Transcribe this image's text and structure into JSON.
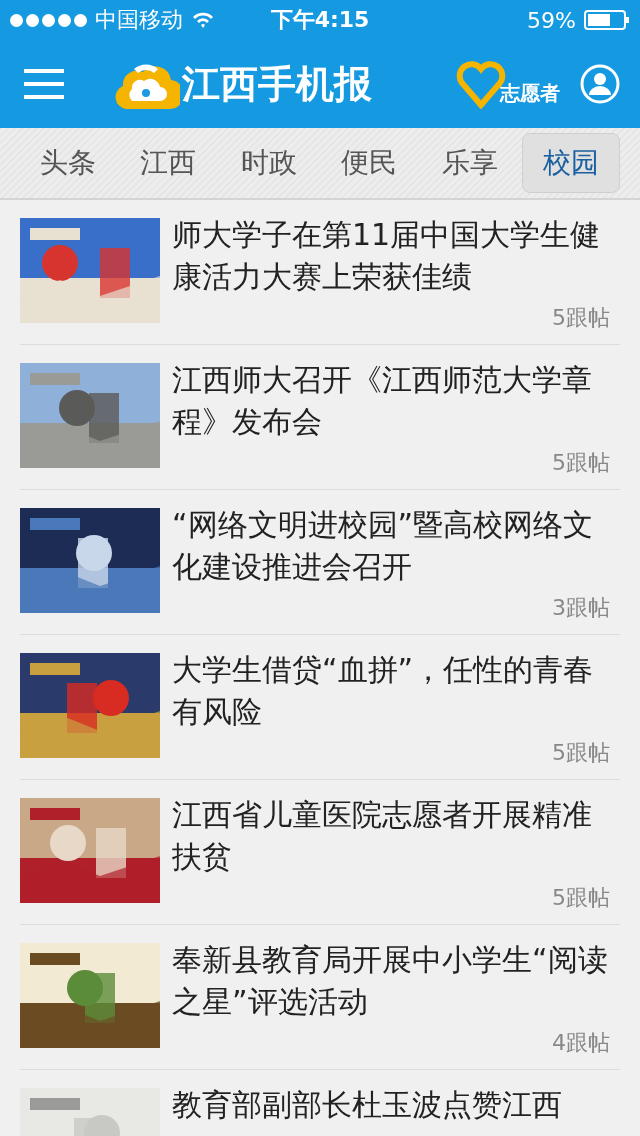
{
  "status_bar": {
    "carrier": "中国移动",
    "time": "下午4:15",
    "battery": "59%"
  },
  "nav_bar": {
    "logo": "江西手机报",
    "volunteer": "志愿者"
  },
  "tabs": [
    {
      "label": "头条",
      "selected": false
    },
    {
      "label": "江西",
      "selected": false
    },
    {
      "label": "时政",
      "selected": false
    },
    {
      "label": "便民",
      "selected": false
    },
    {
      "label": "乐享",
      "selected": false
    },
    {
      "label": "校园",
      "selected": true
    }
  ],
  "articles": [
    {
      "title": "师大学子在第11届中国大学生健康活力大赛上荣获佳绩",
      "replies": "5跟帖",
      "kind": "picture"
    },
    {
      "title": "江西师大召开《江西师范大学章程》发布会",
      "replies": "5跟帖",
      "kind": "picture"
    },
    {
      "title": "“网络文明进校园”暨高校网络文化建设推进会召开",
      "replies": "3跟帖",
      "kind": "picture"
    },
    {
      "title": "大学生借贷“血拼”，任性的青春有风险",
      "replies": "5跟帖",
      "kind": "picture"
    },
    {
      "title": "江西省儿童医院志愿者开展精准扶贫",
      "replies": "5跟帖",
      "kind": "picture"
    },
    {
      "title": "奉新县教育局开展中小学生“阅读之星”评选活动",
      "replies": "4跟帖",
      "kind": "picture"
    },
    {
      "title": "教育部副部长杜玉波点赞江西",
      "kind": "picture"
    }
  ]
}
